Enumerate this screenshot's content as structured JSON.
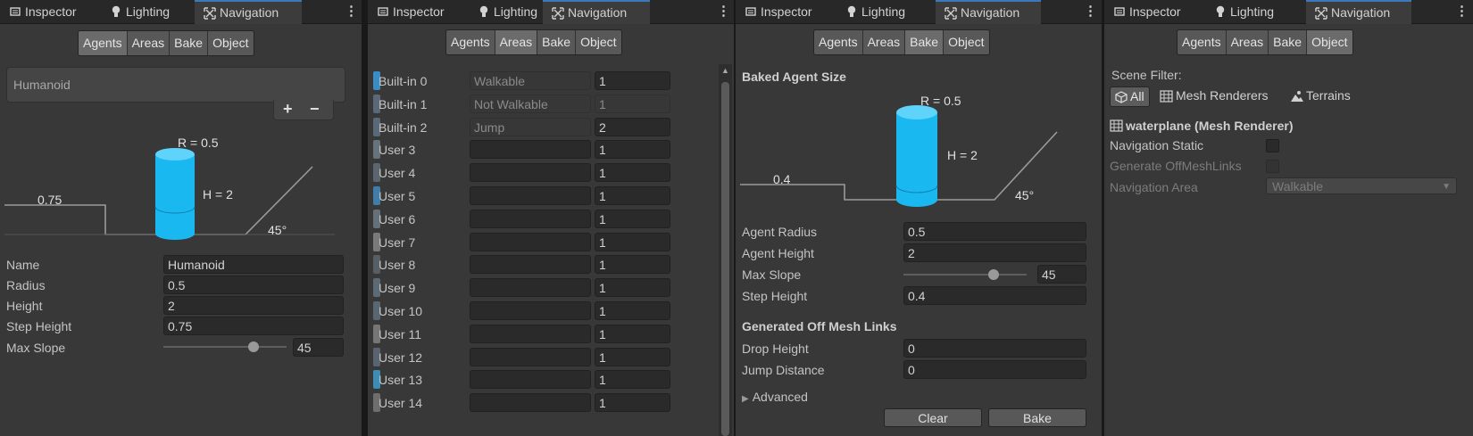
{
  "tabs": {
    "inspector": "Inspector",
    "lighting": "Lighting",
    "navigation": "Navigation"
  },
  "subtabs": {
    "agents": "Agents",
    "areas": "Areas",
    "bake": "Bake",
    "object": "Object"
  },
  "agents": {
    "agent_list": [
      "Humanoid"
    ],
    "add_label": "+",
    "remove_label": "−",
    "diagram": {
      "radius_label": "R = 0.5",
      "height_label": "H = 2",
      "step_label": "0.75",
      "slope_label": "45°"
    },
    "fields": {
      "name_label": "Name",
      "name_value": "Humanoid",
      "radius_label": "Radius",
      "radius_value": "0.5",
      "height_label": "Height",
      "height_value": "2",
      "step_label": "Step Height",
      "step_value": "0.75",
      "slope_label": "Max Slope",
      "slope_value": "45"
    }
  },
  "areas": {
    "rows": [
      {
        "name": "Built-in 0",
        "area": "Walkable",
        "cost": "1",
        "color": "#3a8cc4",
        "readonly_name": true,
        "readonly_cost": false
      },
      {
        "name": "Built-in 1",
        "area": "Not Walkable",
        "cost": "1",
        "color": "#5a6878",
        "readonly_name": true,
        "readonly_cost": true
      },
      {
        "name": "Built-in 2",
        "area": "Jump",
        "cost": "2",
        "color": "#5a6878",
        "readonly_name": true,
        "readonly_cost": false
      },
      {
        "name": "User 3",
        "area": "",
        "cost": "1",
        "color": "#68727c",
        "readonly_name": false,
        "readonly_cost": false
      },
      {
        "name": "User 4",
        "area": "",
        "cost": "1",
        "color": "#5c6670",
        "readonly_name": false,
        "readonly_cost": false
      },
      {
        "name": "User 5",
        "area": "",
        "cost": "1",
        "color": "#3f7ea8",
        "readonly_name": false,
        "readonly_cost": false
      },
      {
        "name": "User 6",
        "area": "",
        "cost": "1",
        "color": "#66707a",
        "readonly_name": false,
        "readonly_cost": false
      },
      {
        "name": "User 7",
        "area": "",
        "cost": "1",
        "color": "#7a7a7a",
        "readonly_name": false,
        "readonly_cost": false
      },
      {
        "name": "User 8",
        "area": "",
        "cost": "1",
        "color": "#565e66",
        "readonly_name": false,
        "readonly_cost": false
      },
      {
        "name": "User 9",
        "area": "",
        "cost": "1",
        "color": "#5c6a76",
        "readonly_name": false,
        "readonly_cost": false
      },
      {
        "name": "User 10",
        "area": "",
        "cost": "1",
        "color": "#5a6670",
        "readonly_name": false,
        "readonly_cost": false
      },
      {
        "name": "User 11",
        "area": "",
        "cost": "1",
        "color": "#767676",
        "readonly_name": false,
        "readonly_cost": false
      },
      {
        "name": "User 12",
        "area": "",
        "cost": "1",
        "color": "#5a6470",
        "readonly_name": false,
        "readonly_cost": false
      },
      {
        "name": "User 13",
        "area": "",
        "cost": "1",
        "color": "#3c8cb4",
        "readonly_name": false,
        "readonly_cost": false
      },
      {
        "name": "User 14",
        "area": "",
        "cost": "1",
        "color": "#6e6e6e",
        "readonly_name": false,
        "readonly_cost": false
      }
    ]
  },
  "bake": {
    "baked_header": "Baked Agent Size",
    "diagram": {
      "radius_label": "R = 0.5",
      "height_label": "H = 2",
      "step_label": "0.4",
      "slope_label": "45°"
    },
    "radius_label": "Agent Radius",
    "radius_value": "0.5",
    "height_label": "Agent Height",
    "height_value": "2",
    "slope_label": "Max Slope",
    "slope_value": "45",
    "step_label": "Step Height",
    "step_value": "0.4",
    "offmesh_header": "Generated Off Mesh Links",
    "drop_label": "Drop Height",
    "drop_value": "0",
    "jump_label": "Jump Distance",
    "jump_value": "0",
    "advanced_label": "Advanced",
    "clear_label": "Clear",
    "bake_label": "Bake"
  },
  "object": {
    "scene_filter_label": "Scene Filter:",
    "filter_all": "All",
    "filter_mesh": "Mesh Renderers",
    "filter_terrains": "Terrains",
    "selected_object": "waterplane (Mesh Renderer)",
    "nav_static_label": "Navigation Static",
    "gen_links_label": "Generate OffMeshLinks",
    "nav_area_label": "Navigation Area",
    "nav_area_value": "Walkable"
  },
  "colors": {
    "capsule": "#1ab8f0",
    "accent": "#3a79bb"
  }
}
